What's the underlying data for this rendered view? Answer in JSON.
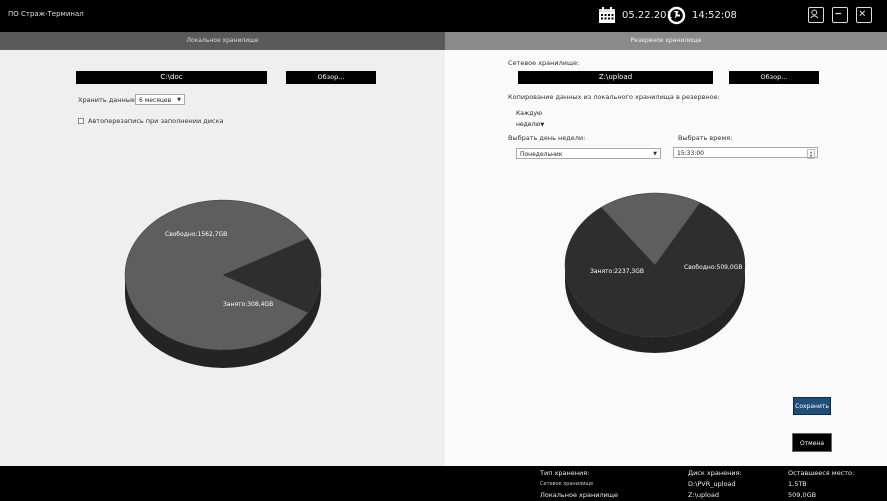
{
  "app": {
    "title": "ПО Страж-Терминал"
  },
  "header": {
    "date": "05.22.2017",
    "time": "14:52:08",
    "date_icon": "calendar-icon",
    "clock_icon": "clock-icon",
    "user_icon": "user-icon",
    "minimize_icon": "minimize-icon",
    "close_icon": "close-icon"
  },
  "tabs": {
    "local": "Локальное хранилище",
    "backup": "Резервное хранилище"
  },
  "local": {
    "path": "C:\\doc",
    "browse": "Обзор...",
    "keep_label": "Хранить данные:",
    "keep_value": "6 месяцев",
    "overwrite_label": "Автоперезапись при заполнении диска",
    "pie": {
      "free_label": "Свободно:1562,7GB",
      "used_label": "Занято:308,4GB"
    }
  },
  "backup": {
    "network_label": "Сетевое хранилище:",
    "path": "Z:\\upload",
    "browse": "Обзор...",
    "copy_label": "Копирование данных из локального хранилища в резервное:",
    "copy_value": "Каждую неделю",
    "day_label": "Выбрать день недели:",
    "day_value": "Понедельник",
    "time_label": "Выбрать время:",
    "time_value": "15:33:00",
    "pie": {
      "used_label": "Занято:2237,3GB",
      "free_label": "Свободно:509,0GB"
    },
    "save": "Сохранить",
    "cancel": "Отмена"
  },
  "status": {
    "headers": [
      "Тип хранения:",
      "Диск хранения:",
      "Оставшееся место:"
    ],
    "rows": [
      [
        "Сетевое хранилище",
        "D:\\PVR_upload",
        "1,5TB"
      ],
      [
        "Локальное хранилище",
        "Z:\\upload",
        "509,0GB"
      ]
    ]
  },
  "chart_data": [
    {
      "type": "pie",
      "categories": [
        "Свободно",
        "Занято"
      ],
      "values": [
        1562.7,
        308.4
      ],
      "unit": "GB"
    },
    {
      "type": "pie",
      "categories": [
        "Занято",
        "Свободно"
      ],
      "values": [
        2237.3,
        509.0
      ],
      "unit": "GB"
    }
  ],
  "colors": {
    "pie_free": "#5e5e5e",
    "pie_used": "#2e2e2e",
    "save_button": "#1f4e79"
  }
}
